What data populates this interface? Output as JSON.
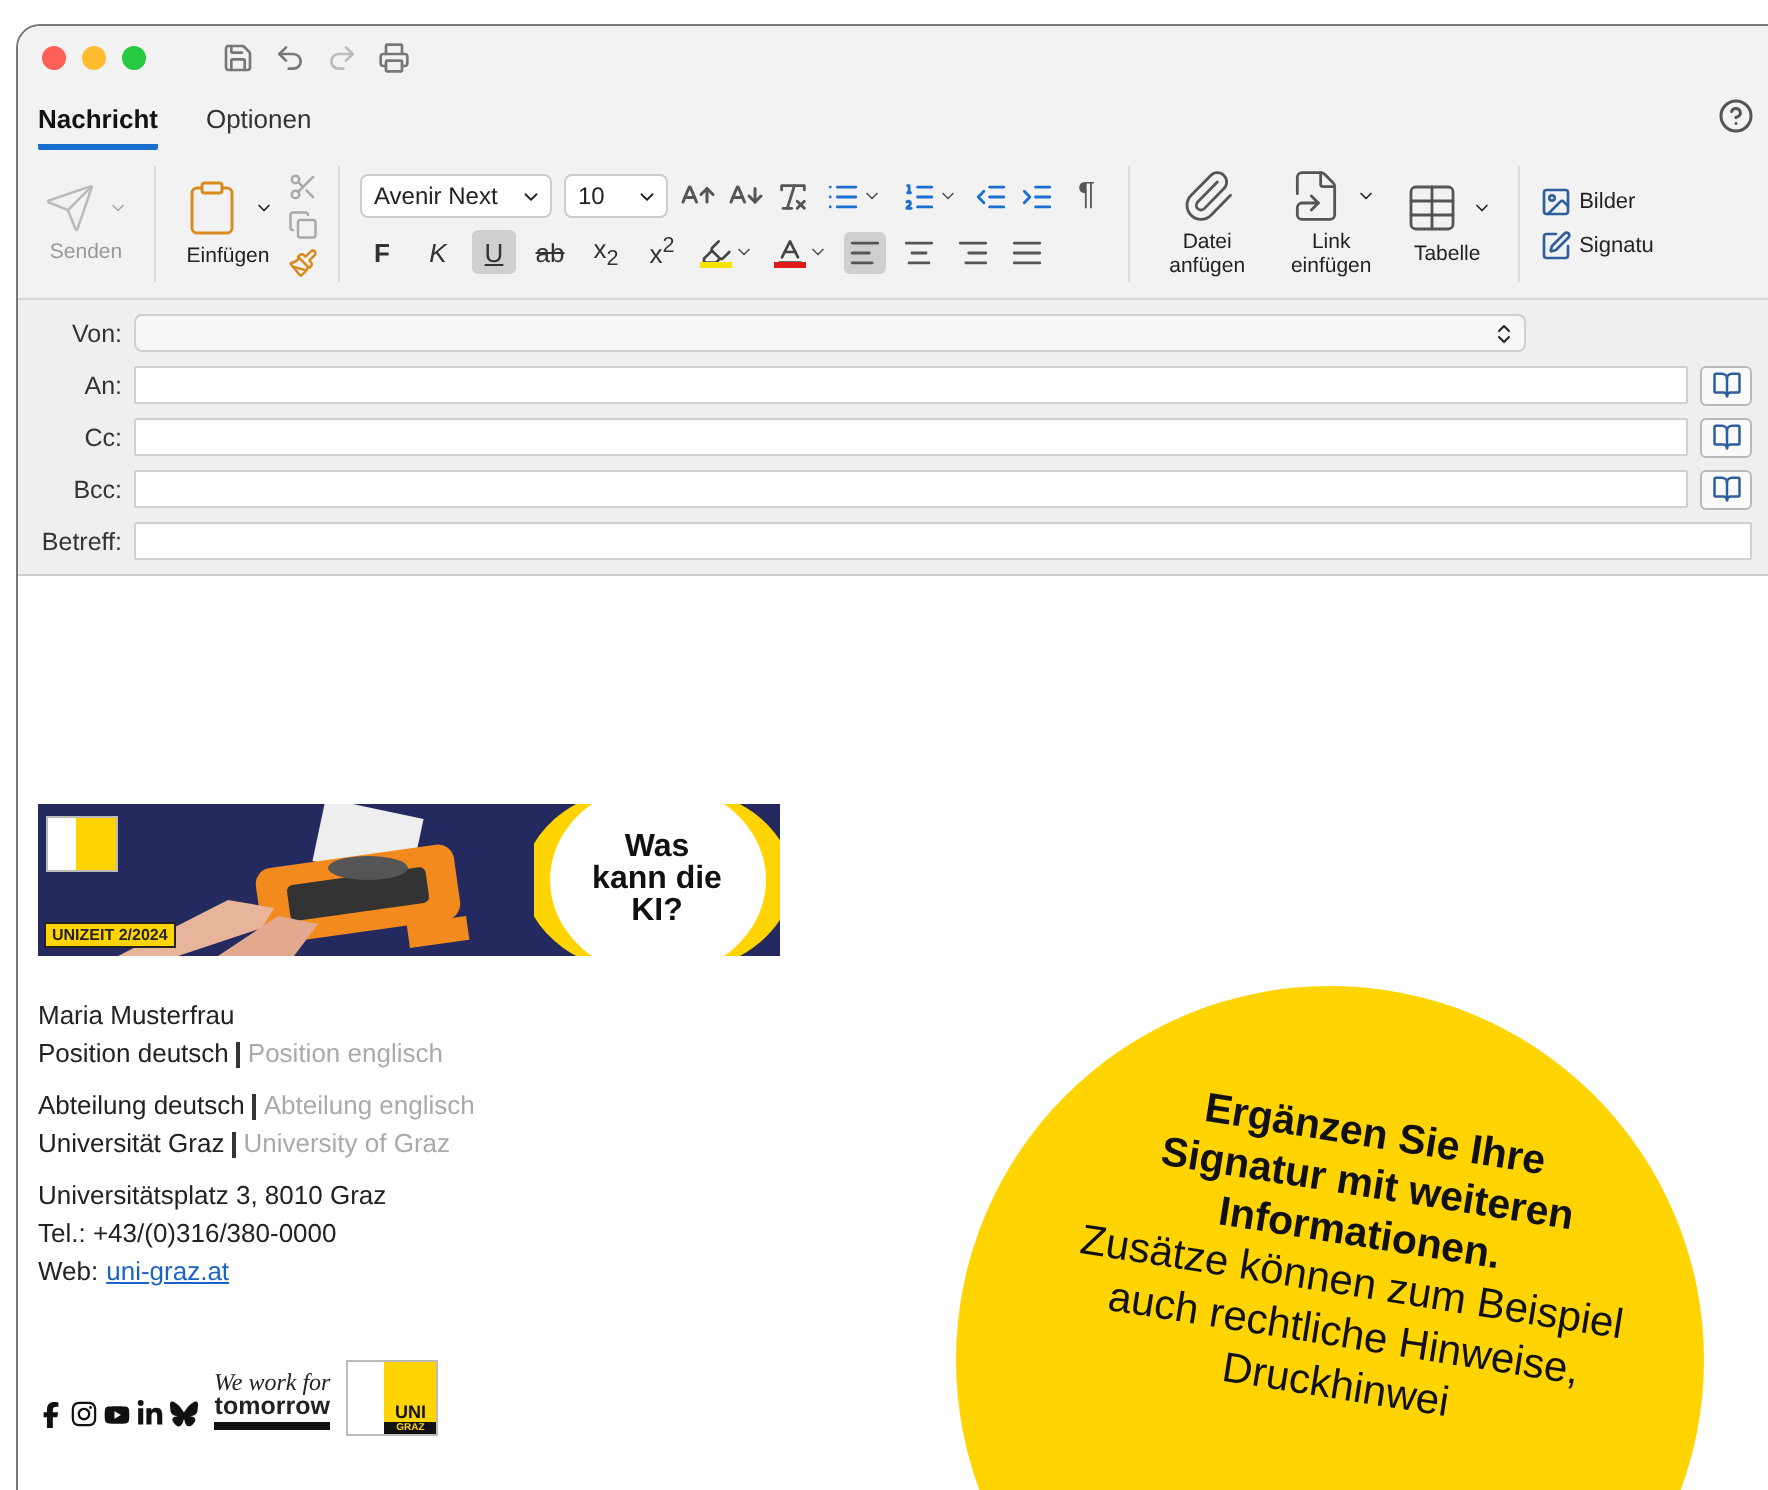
{
  "tabs": [
    {
      "label": "Nachricht",
      "selected": true
    },
    {
      "label": "Optionen",
      "selected": false
    }
  ],
  "ribbon": {
    "send": {
      "label": "Senden",
      "disabled": true
    },
    "paste": {
      "label": "Einfügen"
    },
    "font": {
      "value": "Avenir Next"
    },
    "size": {
      "value": "10"
    },
    "format_buttons": [
      {
        "kind": "bold",
        "label": "F",
        "selected": false
      },
      {
        "kind": "italic",
        "label": "K",
        "selected": false
      },
      {
        "kind": "underline",
        "label": "U",
        "selected": true
      },
      {
        "kind": "strike",
        "label": "ab",
        "selected": false
      },
      {
        "kind": "subscript",
        "label": "x$_{2}$",
        "selected": false
      },
      {
        "kind": "superscript",
        "label": "x$^{2}$",
        "selected": false
      }
    ],
    "color_pickers": [
      {
        "kind": "highlight",
        "color": "#f5e400"
      },
      {
        "kind": "font",
        "color": "#e0191b"
      }
    ],
    "alignment": [
      {
        "kind": "left",
        "selected": true
      },
      {
        "kind": "center",
        "selected": false
      },
      {
        "kind": "right",
        "selected": false
      },
      {
        "kind": "justify",
        "selected": false
      }
    ],
    "pilcrow": "¶",
    "large_buttons": [
      {
        "kind": "attach",
        "label": "Datei anfügen"
      },
      {
        "kind": "link",
        "label": "Link einfügen"
      },
      {
        "kind": "table",
        "label": "Tabelle"
      }
    ],
    "side_buttons": [
      {
        "kind": "images",
        "label": "Bilder"
      },
      {
        "kind": "signature",
        "label": "Signatu"
      }
    ]
  },
  "header_fields": [
    {
      "kind": "select",
      "label": "Von:"
    },
    {
      "kind": "address",
      "label": "An:"
    },
    {
      "kind": "address",
      "label": "Cc:"
    },
    {
      "kind": "address",
      "label": "Bcc:"
    },
    {
      "kind": "text",
      "label": "Betreff:"
    }
  ],
  "signature": {
    "banner": {
      "tag": "UNIZEIT 2/2024",
      "headline": "Was kann die KI?"
    },
    "groups": [
      [
        {
          "main": "Maria Musterfrau"
        },
        {
          "main": "Position deutsch",
          "alt": "Position englisch"
        }
      ],
      [
        {
          "main": "Abteilung deutsch",
          "alt": "Abteilung englisch"
        },
        {
          "main": "Universität Graz",
          "alt": "University of Graz"
        }
      ],
      [
        {
          "main": "Universitätsplatz 3, 8010 Graz"
        },
        {
          "main": "Tel.: +43/(0)316/380-0000"
        },
        {
          "main": "Web:",
          "link": "uni-graz.at"
        }
      ]
    ],
    "slogan": {
      "line_1": "We work for",
      "line_2": "tomorrow"
    },
    "logo": {
      "line_1": "UNI",
      "line_2": "GRAZ"
    }
  },
  "callout": {
    "headline": "Ergänzen Sie Ihre Signatur mit weiteren Informationen.",
    "body": "Zusätze können zum Beispiel auch rechtliche Hinweise, Druckhinwei"
  }
}
